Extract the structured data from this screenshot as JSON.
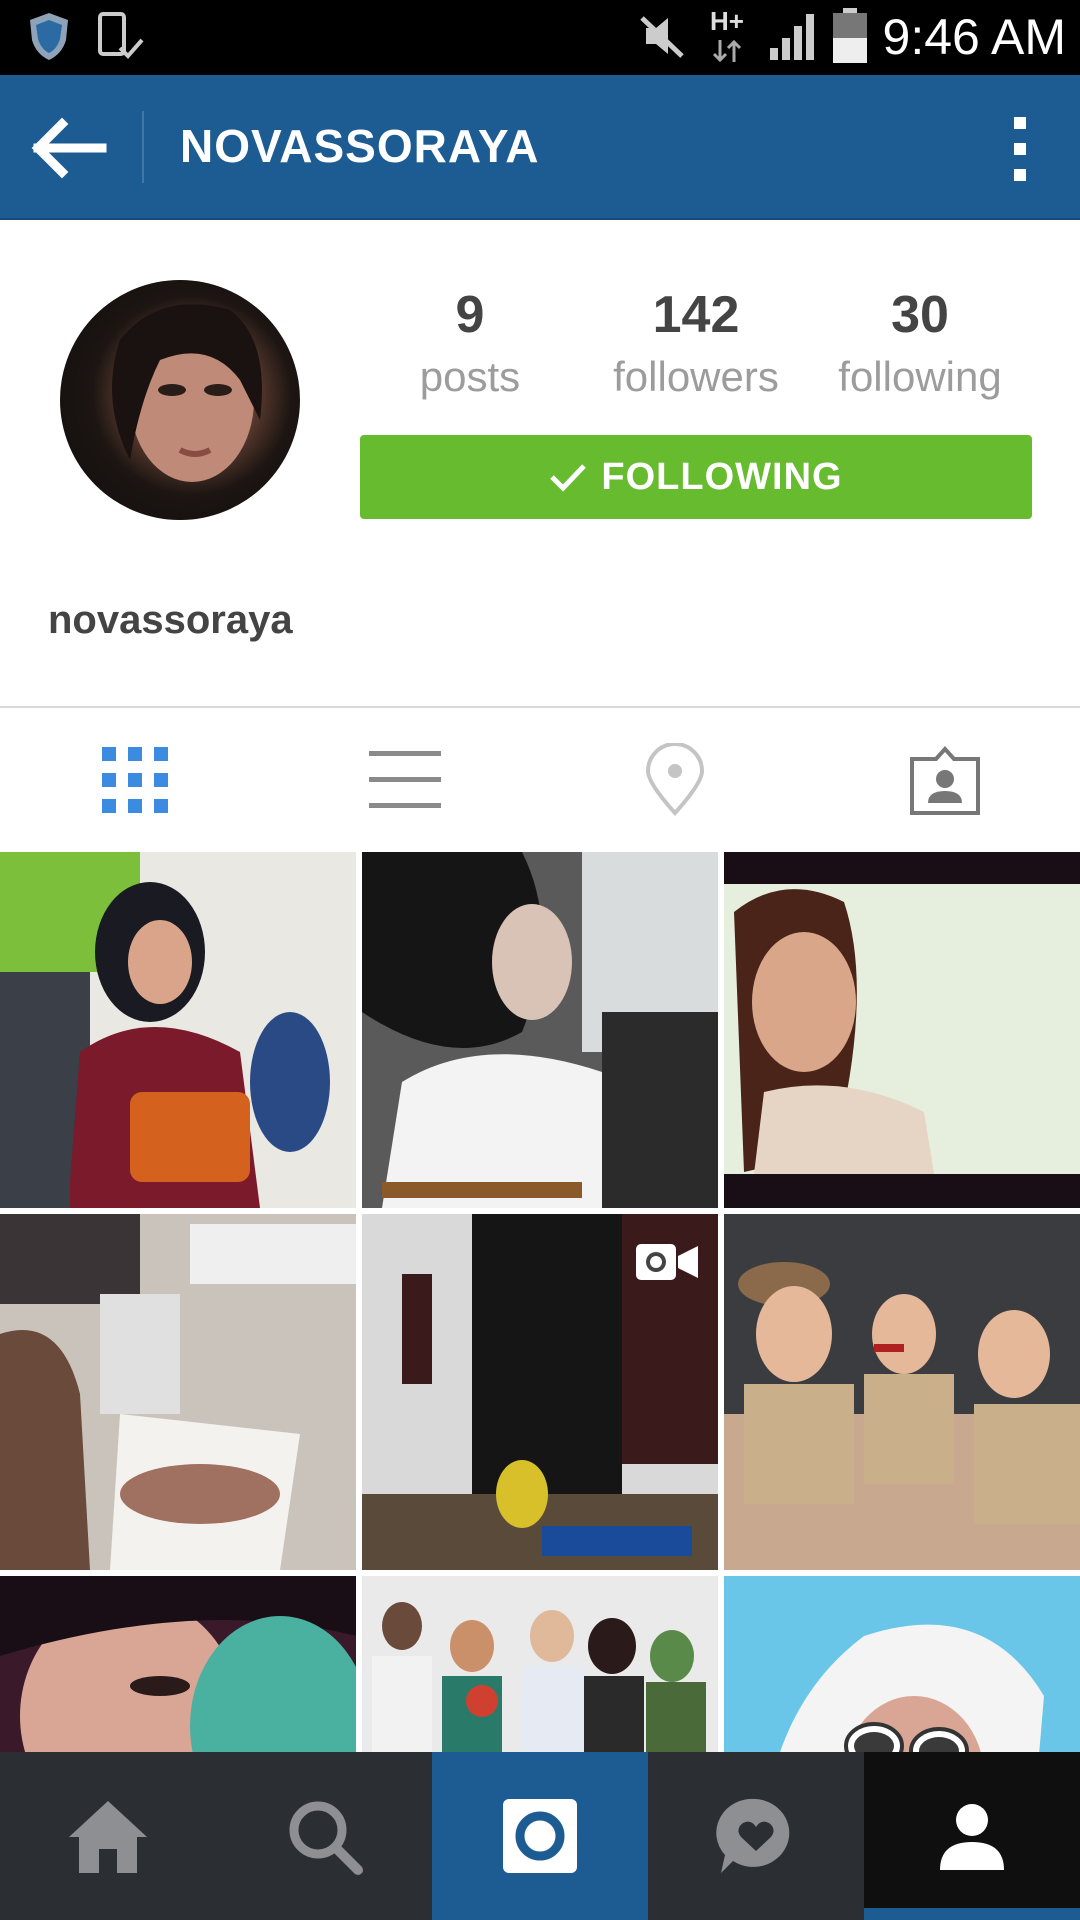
{
  "status_bar": {
    "time": "9:46 AM",
    "network": "H+",
    "icons": [
      "shield-icon",
      "phone-check-icon",
      "mute-icon",
      "network-icon",
      "signal-icon",
      "battery-icon"
    ]
  },
  "header": {
    "title": "NOVASSORAYA",
    "icons": [
      "back-arrow-icon",
      "more-vert-icon"
    ]
  },
  "profile": {
    "username": "novassoraya",
    "stats": [
      {
        "value": "9",
        "label": "posts"
      },
      {
        "value": "142",
        "label": "followers"
      },
      {
        "value": "30",
        "label": "following"
      }
    ],
    "follow_button": "FOLLOWING"
  },
  "tabs": [
    "grid-icon",
    "list-icon",
    "location-pin-icon",
    "tagged-person-icon"
  ],
  "grid": {
    "rows": 3,
    "columns": 3,
    "video_indicator_on_item": 5
  },
  "bottom_nav": [
    "home-icon",
    "search-icon",
    "camera-icon",
    "activity-heart-icon",
    "profile-icon"
  ],
  "colors": {
    "header_blue": "#1d5c93",
    "follow_green": "#66bb2e",
    "tab_active_blue": "#3b8be0",
    "nav_dark": "#2b2f33"
  }
}
